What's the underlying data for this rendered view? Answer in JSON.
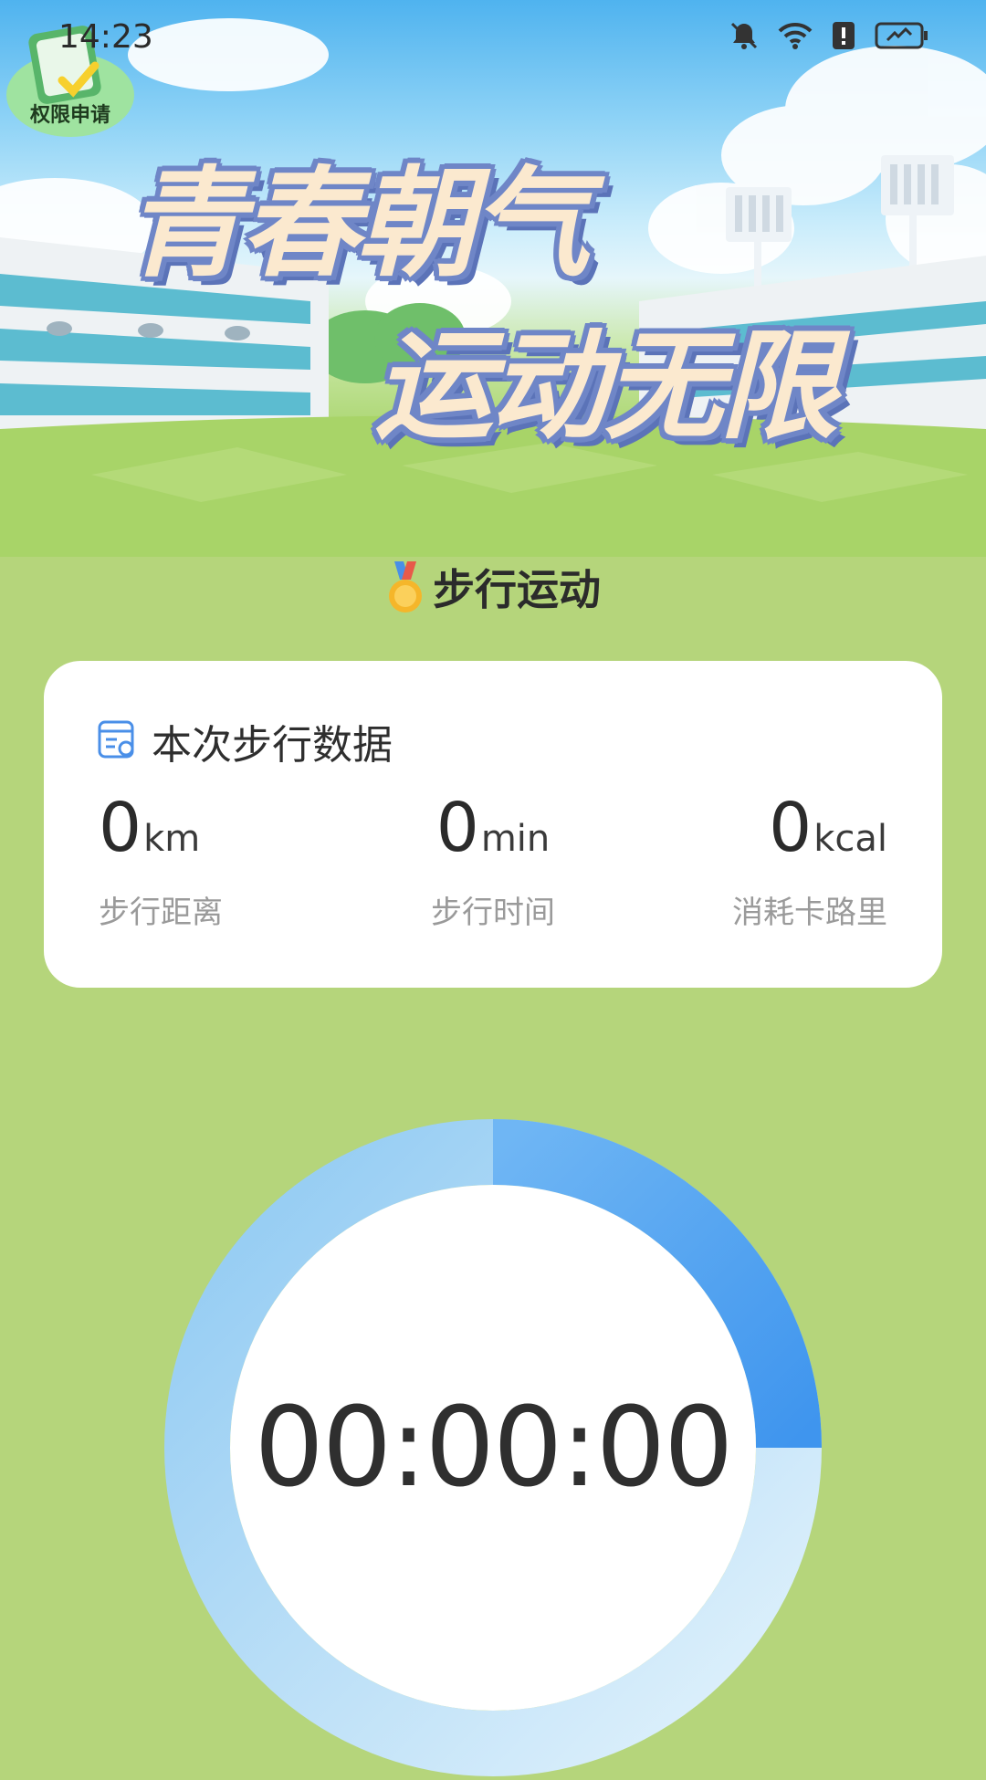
{
  "status_bar": {
    "time": "14:23"
  },
  "permission_badge": {
    "label": "权限申请"
  },
  "hero": {
    "line1": "青春朝气",
    "line2": "运动无限"
  },
  "section": {
    "title": "步行运动",
    "icon": "medal-icon"
  },
  "stats_card": {
    "title": "本次步行数据",
    "icon": "data-report-icon",
    "items": [
      {
        "value": "0",
        "unit": "km",
        "label": "步行距离"
      },
      {
        "value": "0",
        "unit": "min",
        "label": "步行时间"
      },
      {
        "value": "0",
        "unit": "kcal",
        "label": "消耗卡路里"
      }
    ]
  },
  "timer": {
    "display": "00:00:00",
    "progress": 0.25
  },
  "colors": {
    "background": "#b5d57b",
    "ring_active": "#4f9df0",
    "ring_track": "#d9eefb",
    "icon_blue": "#4a8fe8"
  }
}
